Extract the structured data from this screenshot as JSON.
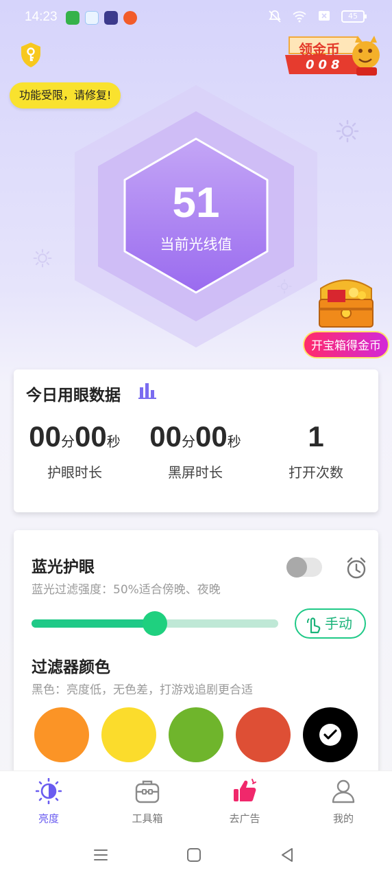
{
  "status_bar": {
    "time": "14:23",
    "battery": "45",
    "icons": [
      "app-notif-icon",
      "file-notif-icon",
      "game-notif-icon",
      "browser-notif-icon",
      "mute-icon",
      "wifi-icon",
      "sim-off-icon",
      "battery-icon"
    ]
  },
  "header": {
    "warning_text": "功能受限，请修复!",
    "coin_title": "领金币",
    "coin_count": "008"
  },
  "hero": {
    "light_value": "51",
    "light_label": "当前光线值"
  },
  "chest": {
    "label": "开宝箱得金币"
  },
  "eye_data": {
    "title": "今日用眼数据",
    "stats": [
      {
        "min": "00",
        "min_unit": "分",
        "sec": "00",
        "sec_unit": "秒",
        "label": "护眼时长"
      },
      {
        "min": "00",
        "min_unit": "分",
        "sec": "00",
        "sec_unit": "秒",
        "label": "黑屏时长"
      },
      {
        "count": "1",
        "label": "打开次数"
      }
    ]
  },
  "blue_light": {
    "title": "蓝光护眼",
    "subtitle": "蓝光过滤强度：50%适合傍晚、夜晚",
    "toggle_on": false,
    "strength_percent": 50,
    "manual_label": "手动"
  },
  "filter": {
    "title": "过滤器颜色",
    "subtitle": "黑色：亮度低，无色差，打游戏追剧更合适",
    "colors": [
      "#fb9426",
      "#fbdc2c",
      "#6fb52c",
      "#de4f35",
      "#000000"
    ],
    "selected_index": 4
  },
  "bottom_nav": {
    "items": [
      {
        "label": "亮度",
        "icon": "brightness-icon",
        "active": true
      },
      {
        "label": "工具箱",
        "icon": "toolbox-icon",
        "active": false
      },
      {
        "label": "去广告",
        "icon": "thumbs-up-icon",
        "active": false
      },
      {
        "label": "我的",
        "icon": "user-icon",
        "active": false
      }
    ]
  },
  "colors": {
    "accent": "#6a5cf0",
    "green": "#1fc987",
    "hexagon": "#a77ef0"
  }
}
